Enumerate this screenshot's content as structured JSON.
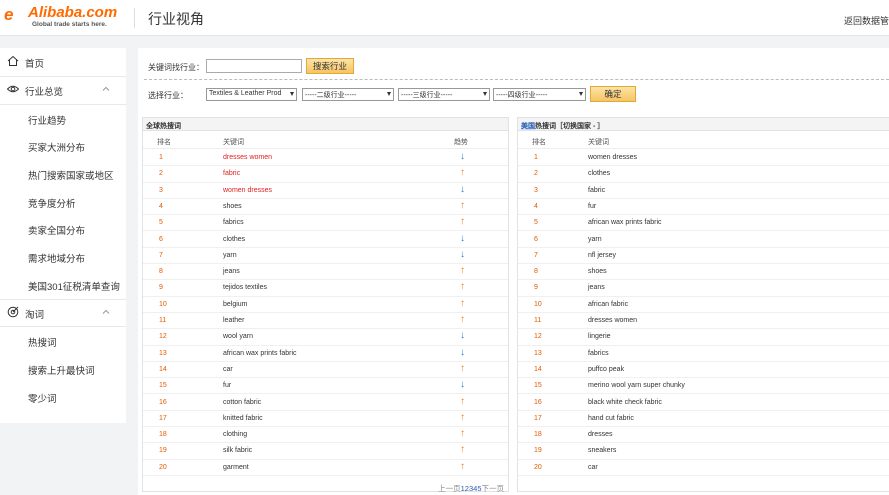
{
  "header": {
    "logo_word": "Alibaba.com",
    "logo_tagline": "Global trade starts here.",
    "page_title": "行业视角",
    "back_link": "返回数据管"
  },
  "sidebar": {
    "home": "首页",
    "overview": "行业总览",
    "overview_items": [
      "行业趋势",
      "买家大洲分布",
      "热门搜索国家或地区",
      "竞争度分析",
      "卖家全国分布",
      "需求地域分布",
      "美国301征税清单查询"
    ],
    "words": "淘词",
    "words_items": [
      "热搜词",
      "搜索上升最快词",
      "零少词"
    ]
  },
  "search": {
    "keyword_label": "关键词找行业：",
    "keyword_value": "",
    "search_button": "搜索行业",
    "select_label": "选择行业：",
    "select_1": "Textiles & Leather Prod",
    "select_2": "-----二级行业-----",
    "select_3": "-----三级行业-----",
    "select_4": "-----四级行业-----",
    "confirm_button": "确定"
  },
  "global_table": {
    "title": "全球热搜词",
    "col_rank": "排名",
    "col_keyword": "关键词",
    "col_trend": "趋势",
    "rows": [
      {
        "rank": "1",
        "keyword": "dresses women",
        "trend": "down",
        "red": true
      },
      {
        "rank": "2",
        "keyword": "fabric",
        "trend": "up",
        "red": true
      },
      {
        "rank": "3",
        "keyword": "women dresses",
        "trend": "down",
        "red": true
      },
      {
        "rank": "4",
        "keyword": "shoes",
        "trend": "up",
        "red": false
      },
      {
        "rank": "5",
        "keyword": "fabrics",
        "trend": "up",
        "red": false
      },
      {
        "rank": "6",
        "keyword": "clothes",
        "trend": "down",
        "red": false
      },
      {
        "rank": "7",
        "keyword": "yarn",
        "trend": "down",
        "red": false
      },
      {
        "rank": "8",
        "keyword": "jeans",
        "trend": "up",
        "red": false
      },
      {
        "rank": "9",
        "keyword": "tejidos textiles",
        "trend": "up",
        "red": false
      },
      {
        "rank": "10",
        "keyword": "belgium",
        "trend": "up",
        "red": false
      },
      {
        "rank": "11",
        "keyword": "leather",
        "trend": "up",
        "red": false
      },
      {
        "rank": "12",
        "keyword": "wool yarn",
        "trend": "down",
        "red": false
      },
      {
        "rank": "13",
        "keyword": "african wax prints fabric",
        "trend": "down",
        "red": false
      },
      {
        "rank": "14",
        "keyword": "car",
        "trend": "up",
        "red": false
      },
      {
        "rank": "15",
        "keyword": "fur",
        "trend": "down",
        "red": false
      },
      {
        "rank": "16",
        "keyword": "cotton fabric",
        "trend": "up",
        "red": false
      },
      {
        "rank": "17",
        "keyword": "knitted fabric",
        "trend": "up",
        "red": false
      },
      {
        "rank": "18",
        "keyword": "clothing",
        "trend": "up",
        "red": false
      },
      {
        "rank": "19",
        "keyword": "silk fabric",
        "trend": "up",
        "red": false
      },
      {
        "rank": "20",
        "keyword": "garment",
        "trend": "up",
        "red": false
      }
    ],
    "pager_prev": "上一页",
    "pager_pages": "12345",
    "pager_next": "下一页"
  },
  "country_table": {
    "title_country": "美国",
    "title_rest": "热搜词［切换国家 - ］",
    "col_rank": "排名",
    "col_keyword": "关键词",
    "rows": [
      {
        "rank": "1",
        "keyword": "women dresses"
      },
      {
        "rank": "2",
        "keyword": "clothes"
      },
      {
        "rank": "3",
        "keyword": "fabric"
      },
      {
        "rank": "4",
        "keyword": "fur"
      },
      {
        "rank": "5",
        "keyword": "african wax prints fabric"
      },
      {
        "rank": "6",
        "keyword": "yarn"
      },
      {
        "rank": "7",
        "keyword": "nfl jersey"
      },
      {
        "rank": "8",
        "keyword": "shoes"
      },
      {
        "rank": "9",
        "keyword": "jeans"
      },
      {
        "rank": "10",
        "keyword": "african fabric"
      },
      {
        "rank": "11",
        "keyword": "dresses women"
      },
      {
        "rank": "12",
        "keyword": "lingerie"
      },
      {
        "rank": "13",
        "keyword": "fabrics"
      },
      {
        "rank": "14",
        "keyword": "puffco peak"
      },
      {
        "rank": "15",
        "keyword": "merino wool yarn super chunky"
      },
      {
        "rank": "16",
        "keyword": "black white check fabric"
      },
      {
        "rank": "17",
        "keyword": "hand cut fabric"
      },
      {
        "rank": "18",
        "keyword": "dresses"
      },
      {
        "rank": "19",
        "keyword": "sneakers"
      },
      {
        "rank": "20",
        "keyword": "car"
      }
    ]
  },
  "colors": {
    "brand": "#ff6a00",
    "trend_up": "#f27b1a",
    "trend_down": "#2a7ad4",
    "rank": "#e05a00",
    "highlight_keyword": "#e02020"
  }
}
